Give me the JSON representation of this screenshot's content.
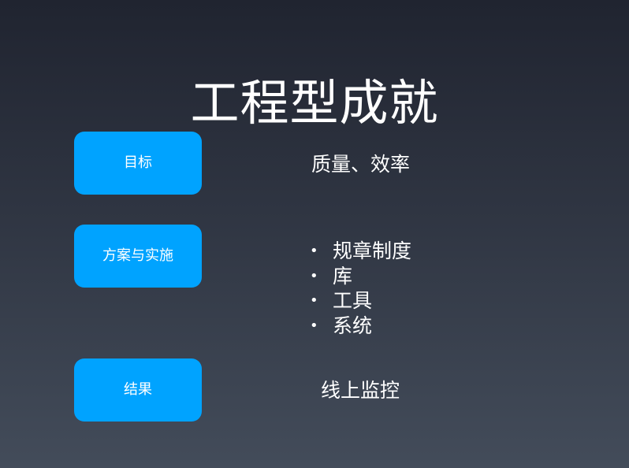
{
  "slide": {
    "title": "工程型成就",
    "sections": [
      {
        "label": "目标",
        "content": "质量、效率"
      },
      {
        "label": "方案与实施",
        "items": [
          "规章制度",
          "库",
          "工具",
          "系统"
        ]
      },
      {
        "label": "结果",
        "content": "线上监控"
      }
    ]
  },
  "colors": {
    "background_top": "#202430",
    "background_bottom": "#434c5a",
    "button_blue": "#00a3ff",
    "text_white": "#ffffff"
  }
}
